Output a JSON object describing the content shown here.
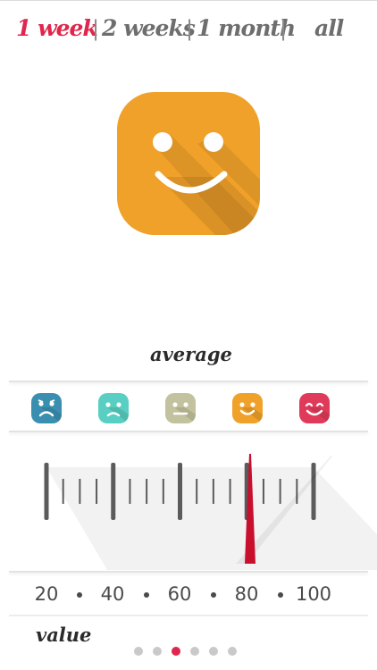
{
  "tabs": [
    {
      "label": "1 week",
      "active": true
    },
    {
      "label": "2 weeks",
      "active": false
    },
    {
      "label": "1 month",
      "active": false
    },
    {
      "label": "all",
      "active": false
    }
  ],
  "separator": "|",
  "average": {
    "label": "average",
    "mood_icon": "smiley-face-icon",
    "color": "#f0a12a"
  },
  "moods": [
    {
      "icon": "sad-face-icon",
      "color": "#3a8fb0"
    },
    {
      "icon": "unhappy-face-icon",
      "color": "#58cfc2"
    },
    {
      "icon": "neutral-face-icon",
      "color": "#c3c29e"
    },
    {
      "icon": "smiley-face-icon",
      "color": "#f0a12a"
    },
    {
      "icon": "happy-face-icon",
      "color": "#e03a5a"
    }
  ],
  "scale": {
    "values": [
      "20",
      "40",
      "60",
      "80",
      "100"
    ],
    "min": 20,
    "max": 100,
    "current": 81,
    "needle_color": "#c8102e"
  },
  "value_label": "value",
  "pager": {
    "count": 6,
    "active_index": 2,
    "active_color": "#e0264c"
  }
}
